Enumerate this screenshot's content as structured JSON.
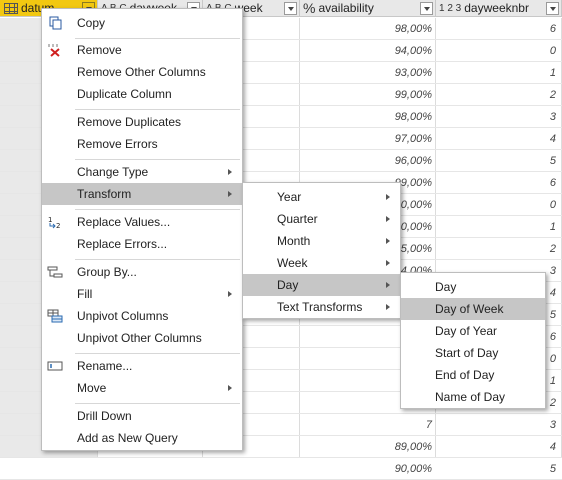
{
  "columns": [
    {
      "type": "",
      "name": "datum",
      "selected": true
    },
    {
      "type": "A B C",
      "name": "dayweek"
    },
    {
      "type": "A B C",
      "name": "week"
    },
    {
      "type": "%",
      "name": "availability"
    },
    {
      "type": "1 2 3",
      "name": "dayweeknbr"
    }
  ],
  "rows": [
    {
      "availability": "98,00%",
      "dayweeknbr": "6"
    },
    {
      "availability": "94,00%",
      "dayweeknbr": "0"
    },
    {
      "availability": "93,00%",
      "dayweeknbr": "1"
    },
    {
      "availability": "99,00%",
      "dayweeknbr": "2"
    },
    {
      "availability": "98,00%",
      "dayweeknbr": "3"
    },
    {
      "availability": "97,00%",
      "dayweeknbr": "4"
    },
    {
      "availability": "96,00%",
      "dayweeknbr": "5"
    },
    {
      "availability": "99,00%",
      "dayweeknbr": "6"
    },
    {
      "availability": "0,00%",
      "dayweeknbr": "0"
    },
    {
      "availability": "0,00%",
      "dayweeknbr": "1"
    },
    {
      "availability": "5,00%",
      "dayweeknbr": "2"
    },
    {
      "availability": "4,00%",
      "dayweeknbr": "3"
    },
    {
      "availability": "",
      "dayweeknbr": "4"
    },
    {
      "availability": "9",
      "dayweeknbr": "5"
    },
    {
      "availability": "9",
      "dayweeknbr": "6"
    },
    {
      "availability": "10",
      "dayweeknbr": "0"
    },
    {
      "availability": "10",
      "dayweeknbr": "1"
    },
    {
      "availability": "10",
      "dayweeknbr": "2"
    },
    {
      "availability": "7",
      "dayweeknbr": "3"
    },
    {
      "availability": "89,00%",
      "dayweeknbr": "4"
    },
    {
      "availability": "90,00%",
      "dayweeknbr": "5"
    }
  ],
  "context_menu": {
    "copy": "Copy",
    "remove": "Remove",
    "remove_other": "Remove Other Columns",
    "duplicate": "Duplicate Column",
    "remove_duplicates": "Remove Duplicates",
    "remove_errors": "Remove Errors",
    "change_type": "Change Type",
    "transform": "Transform",
    "replace_values": "Replace Values...",
    "replace_errors": "Replace Errors...",
    "group_by": "Group By...",
    "fill": "Fill",
    "unpivot": "Unpivot Columns",
    "unpivot_other": "Unpivot Other Columns",
    "rename": "Rename...",
    "move": "Move",
    "drill_down": "Drill Down",
    "add_query": "Add as New Query"
  },
  "transform_menu": {
    "year": "Year",
    "quarter": "Quarter",
    "month": "Month",
    "week": "Week",
    "day": "Day",
    "text_transforms": "Text Transforms"
  },
  "day_menu": {
    "day": "Day",
    "day_of_week": "Day of Week",
    "day_of_year": "Day of Year",
    "start_of_day": "Start of Day",
    "end_of_day": "End of Day",
    "name_of_day": "Name of Day"
  },
  "colors": {
    "selected_header": "#f2c811",
    "menu_highlight": "#c6c6c6"
  }
}
